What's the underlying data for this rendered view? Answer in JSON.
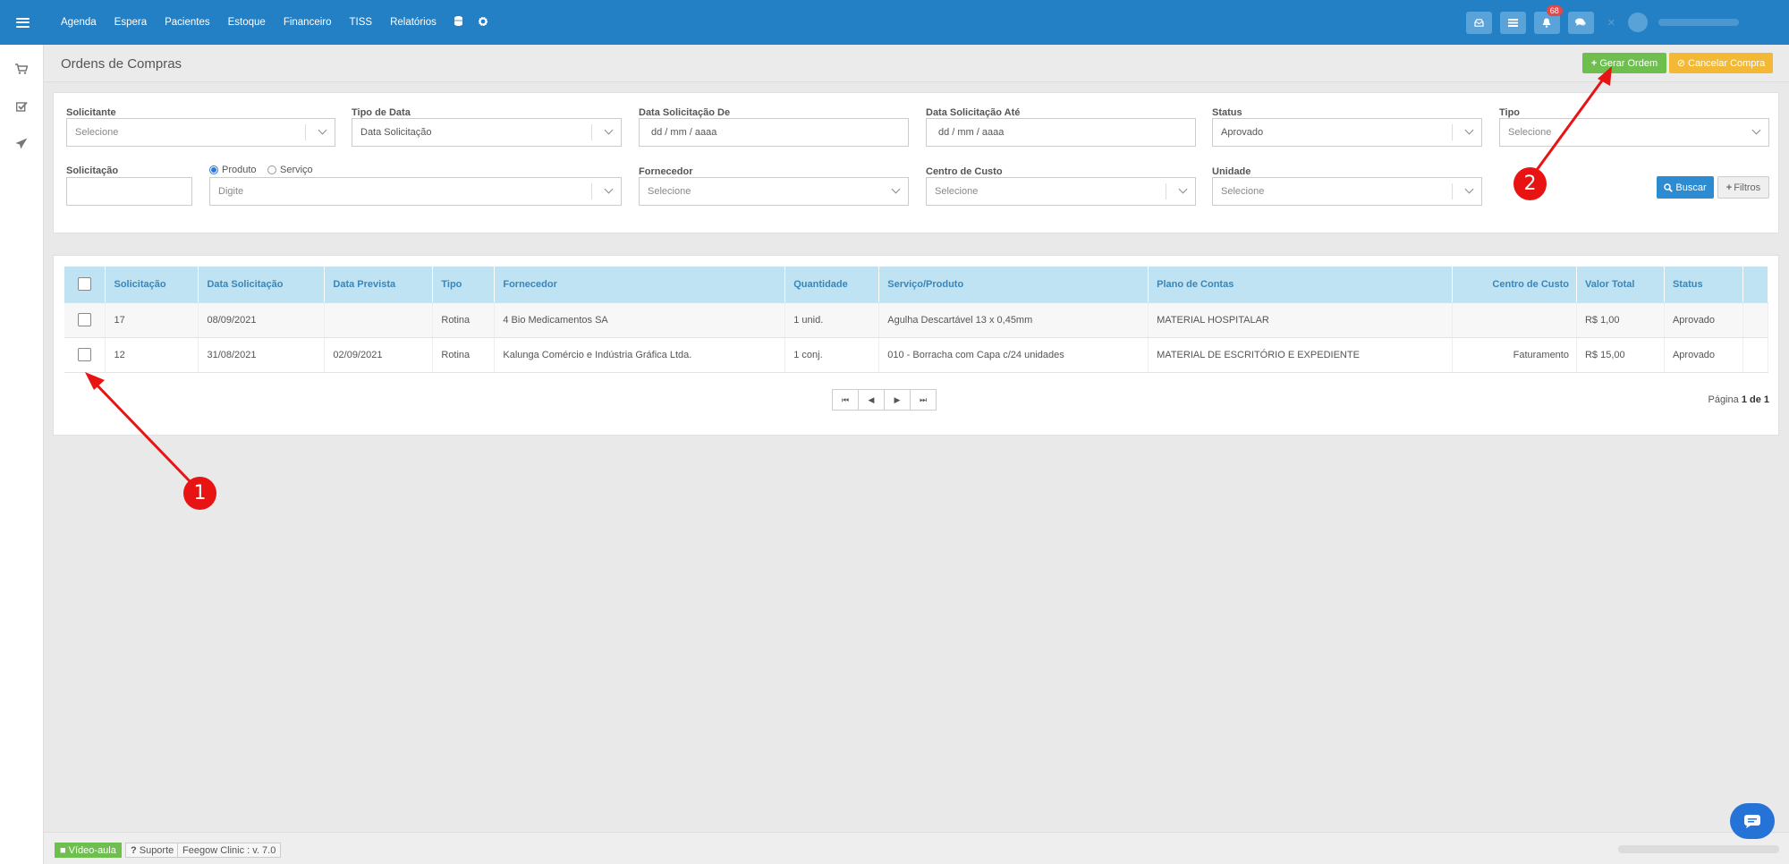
{
  "nav": {
    "items": [
      "Agenda",
      "Espera",
      "Pacientes",
      "Estoque",
      "Financeiro",
      "TISS",
      "Relatórios"
    ],
    "notification_count": "68"
  },
  "page": {
    "title": "Ordens de Compras",
    "generate_order_label": "Gerar Ordem",
    "cancel_purchase_label": "Cancelar Compra"
  },
  "filters": {
    "solicitante": {
      "label": "Solicitante",
      "placeholder": "Selecione"
    },
    "tipo_data": {
      "label": "Tipo de Data",
      "value": "Data Solicitação"
    },
    "data_de": {
      "label": "Data Solicitação De",
      "placeholder": "dd / mm / aaaa"
    },
    "data_ate": {
      "label": "Data Solicitação Até",
      "placeholder": "dd / mm / aaaa"
    },
    "status": {
      "label": "Status",
      "value": "Aprovado"
    },
    "tipo": {
      "label": "Tipo",
      "placeholder": "Selecione"
    },
    "solicitacao": {
      "label": "Solicitação",
      "value": ""
    },
    "produto_radio": "Produto",
    "servico_radio": "Serviço",
    "item": {
      "placeholder": "Digite"
    },
    "fornecedor": {
      "label": "Fornecedor",
      "placeholder": "Selecione"
    },
    "centro_custo": {
      "label": "Centro de Custo",
      "placeholder": "Selecione"
    },
    "unidade": {
      "label": "Unidade",
      "placeholder": "Selecione"
    },
    "search_label": "Buscar",
    "filters_label": "Filtros"
  },
  "table": {
    "headers": [
      "Solicitação",
      "Data Solicitação",
      "Data Prevista",
      "Tipo",
      "Fornecedor",
      "Quantidade",
      "Serviço/Produto",
      "Plano de Contas",
      "Centro de Custo",
      "Valor Total",
      "Status"
    ],
    "rows": [
      {
        "solicitacao": "17",
        "data_solicitacao": "08/09/2021",
        "data_prevista": "",
        "tipo": "Rotina",
        "fornecedor": "4 Bio Medicamentos SA",
        "quantidade": "1 unid.",
        "servico_produto": "Agulha Descartável 13 x 0,45mm",
        "plano_contas": "MATERIAL HOSPITALAR",
        "centro_custo": "",
        "valor_total": "R$ 1,00",
        "status": "Aprovado"
      },
      {
        "solicitacao": "12",
        "data_solicitacao": "31/08/2021",
        "data_prevista": "02/09/2021",
        "tipo": "Rotina",
        "fornecedor": "Kalunga Comércio e Indústria Gráfica Ltda.",
        "quantidade": "1 conj.",
        "servico_produto": "010 - Borracha com Capa c/24 unidades",
        "plano_contas": "MATERIAL DE ESCRITÓRIO E EXPEDIENTE",
        "centro_custo": "Faturamento",
        "valor_total": "R$ 15,00",
        "status": "Aprovado"
      }
    ]
  },
  "pagination": {
    "prefix": "Página",
    "current": "1 de 1"
  },
  "footer": {
    "video_label": "Vídeo-aula",
    "support_label": "Suporte",
    "version_label": "Feegow Clinic : v. 7.0"
  },
  "markers": {
    "one": "1",
    "two": "2"
  },
  "colors": {
    "topbar": "#2380c4",
    "primary": "#2d8bd2",
    "success": "#6ebf4e",
    "warning": "#f3b935",
    "table_header": "#bfe3f2",
    "annotation": "#e81414"
  }
}
